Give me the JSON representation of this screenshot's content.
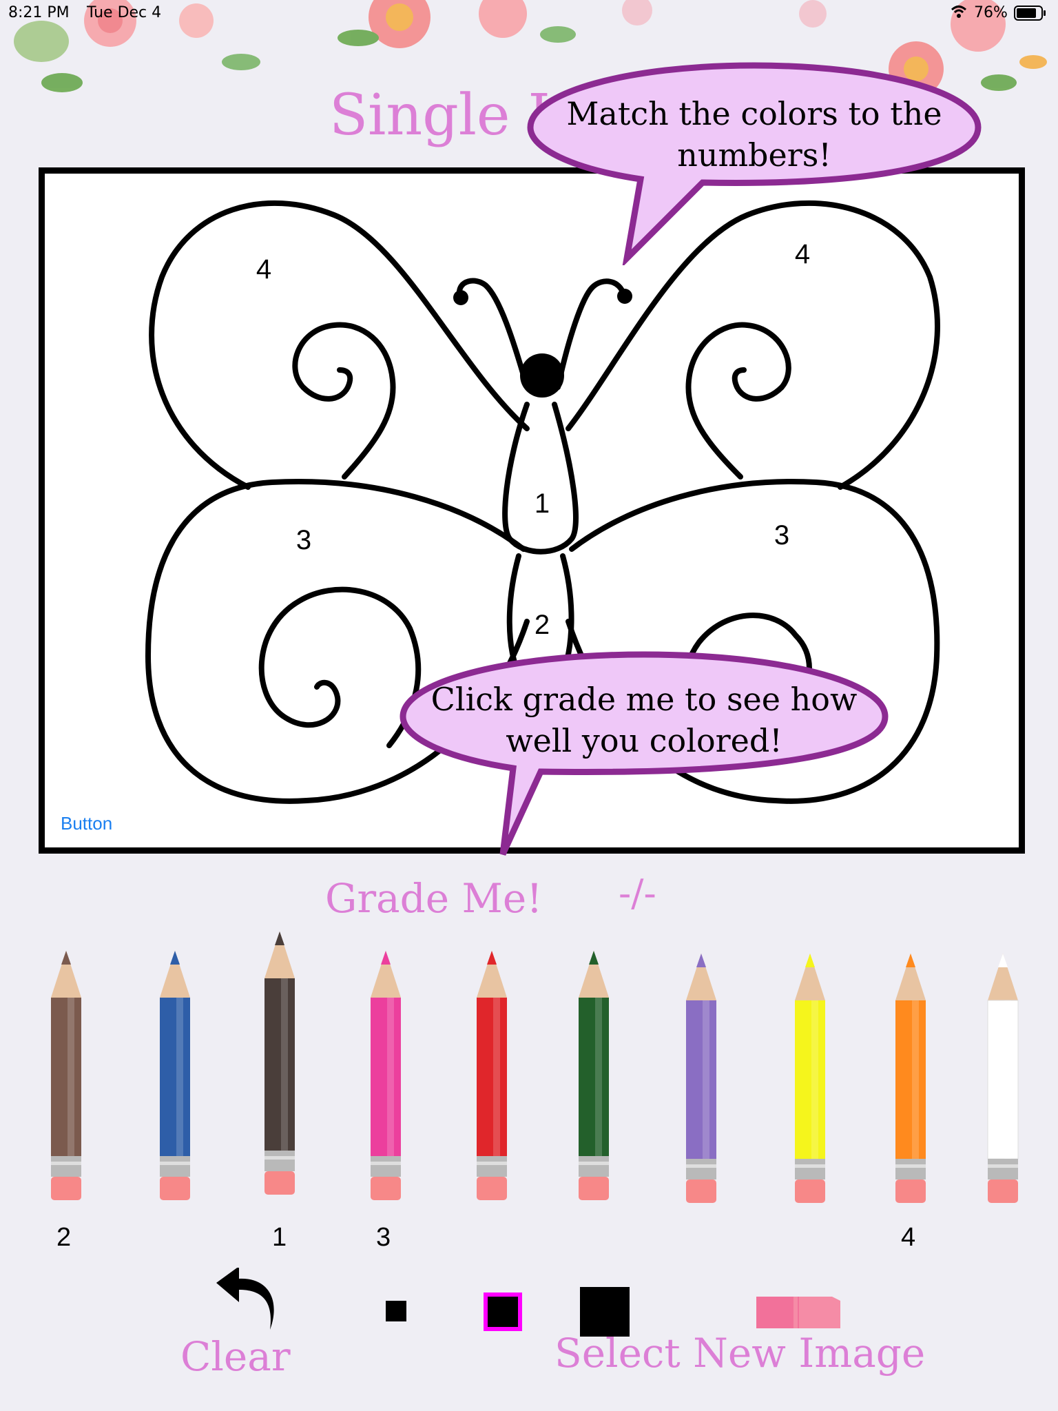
{
  "status_bar": {
    "time": "8:21 PM",
    "date": "Tue Dec 4",
    "battery": "76%"
  },
  "title": "Single I",
  "bubbles": {
    "top": "Match the colors to the numbers!",
    "bottom": "Click grade me to see how well you colored!"
  },
  "image_labels": {
    "top_left": "4",
    "top_right": "4",
    "body_top": "1",
    "body_bottom": "2",
    "bottom_left": "3",
    "bottom_right": "3"
  },
  "canvas_button": "Button",
  "grade_button": "Grade Me!",
  "score": "-/-",
  "pencils": [
    {
      "name": "brown",
      "color": "#7b5a4e",
      "number": "2"
    },
    {
      "name": "blue",
      "color": "#2e5ea8",
      "number": ""
    },
    {
      "name": "black",
      "color": "#4a3e3a",
      "number": "1"
    },
    {
      "name": "pink",
      "color": "#ec3f9d",
      "number": "3"
    },
    {
      "name": "red",
      "color": "#e0262b",
      "number": ""
    },
    {
      "name": "green",
      "color": "#23602b",
      "number": ""
    },
    {
      "name": "purple",
      "color": "#8a6ec3",
      "number": ""
    },
    {
      "name": "yellow",
      "color": "#f5f51c",
      "number": ""
    },
    {
      "name": "orange",
      "color": "#ff8a1e",
      "number": "4"
    },
    {
      "name": "white",
      "color": "#ffffff",
      "number": ""
    }
  ],
  "tools": {
    "clear_label": "Clear",
    "new_image_label": "Select New Image",
    "selected_brush": "medium"
  },
  "colors": {
    "accent": "#dc7fd6",
    "bubble_fill": "#efc8f8",
    "bubble_stroke": "#8c2a92"
  }
}
